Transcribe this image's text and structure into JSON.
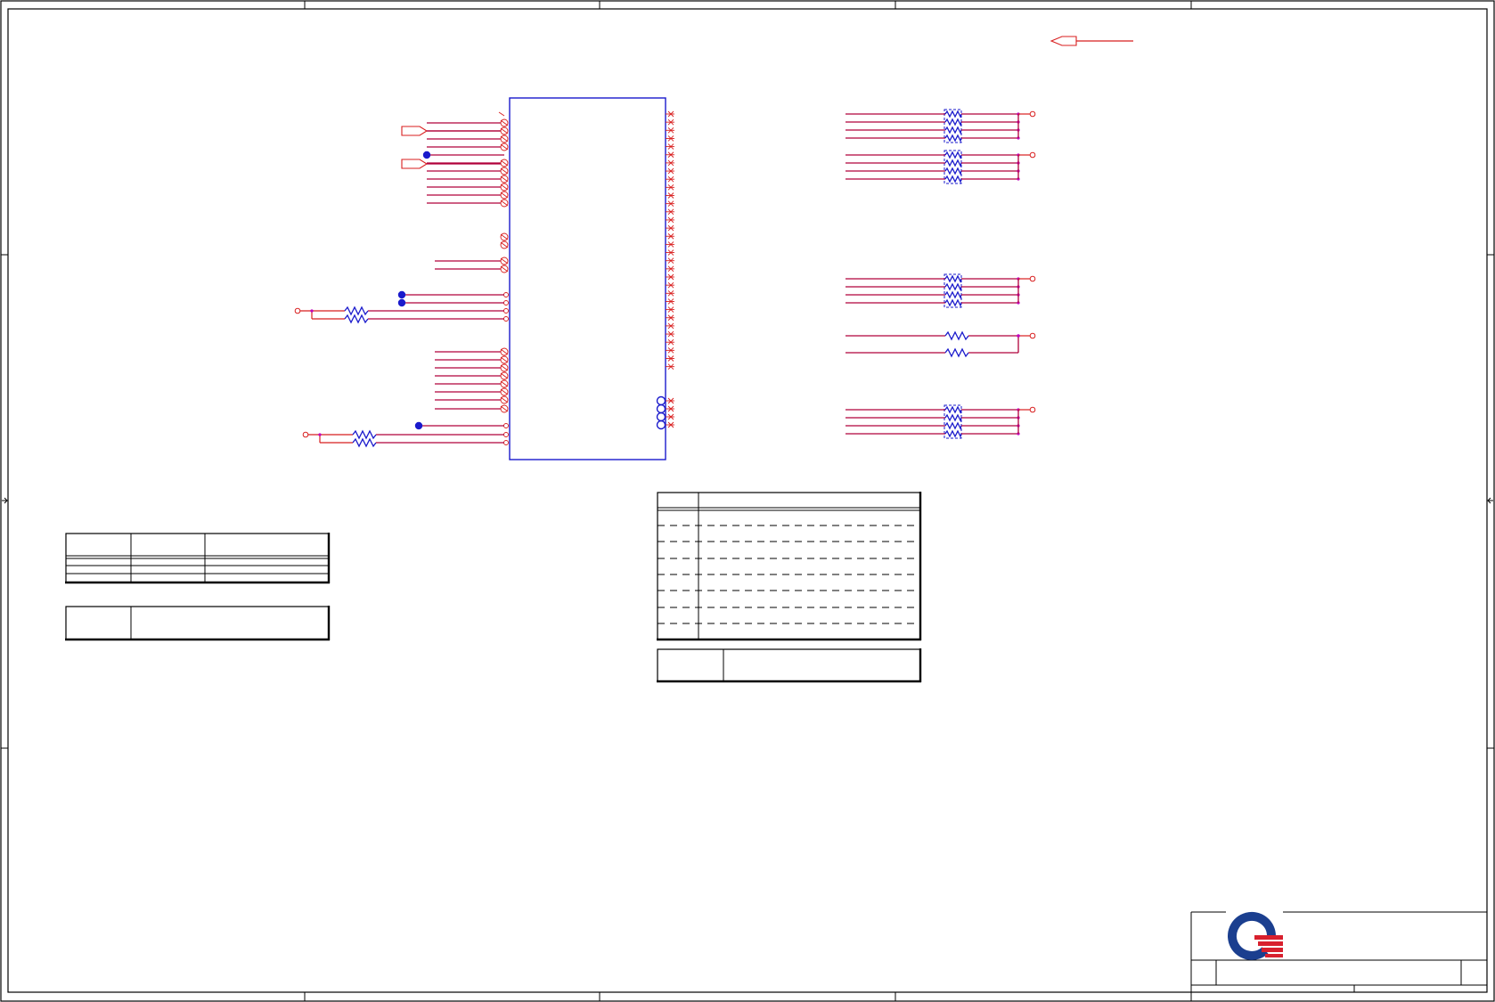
{
  "sheet": {
    "logo": "quanta-logo",
    "colors": {
      "logo_blue": "#1b3f8f",
      "logo_red": "#d8202e",
      "ic_outline": "#1a1acc",
      "wire": "#b0003a",
      "pin": "#d81e1e",
      "junction": "#c000c0"
    }
  }
}
